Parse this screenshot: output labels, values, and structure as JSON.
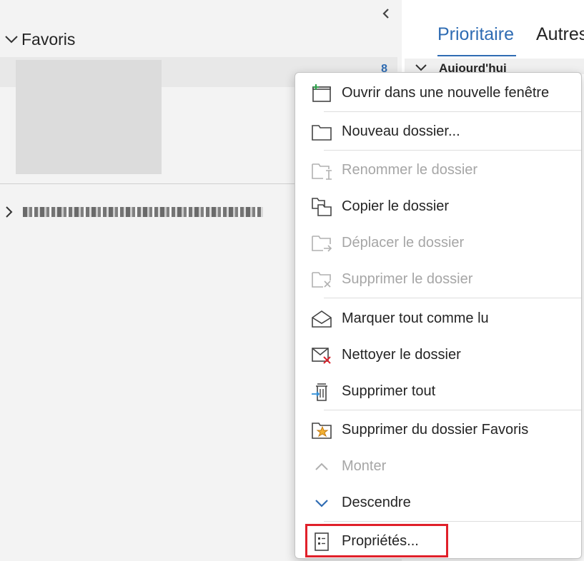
{
  "folder_pane": {
    "favorites_label": "Favoris",
    "favorites_count": "8"
  },
  "mail_list": {
    "tabs": [
      "Prioritaire",
      "Autres"
    ],
    "group_header": "Aujourd'hui"
  },
  "context_menu": {
    "items": [
      {
        "label": "Ouvrir dans une nouvelle fenêtre",
        "icon": "new-window-icon",
        "enabled": true
      },
      {
        "label": "Nouveau dossier...",
        "icon": "new-folder-icon",
        "enabled": true
      },
      {
        "label": "Renommer le dossier",
        "icon": "rename-folder-icon",
        "enabled": false
      },
      {
        "label": "Copier le dossier",
        "icon": "copy-folder-icon",
        "enabled": true
      },
      {
        "label": "Déplacer le dossier",
        "icon": "move-folder-icon",
        "enabled": false
      },
      {
        "label": "Supprimer le dossier",
        "icon": "delete-folder-icon",
        "enabled": false
      },
      {
        "label": "Marquer tout comme lu",
        "icon": "mark-read-icon",
        "enabled": true
      },
      {
        "label": "Nettoyer le dossier",
        "icon": "clean-folder-icon",
        "enabled": true
      },
      {
        "label": "Supprimer tout",
        "icon": "delete-all-icon",
        "enabled": true
      },
      {
        "label": "Supprimer du dossier Favoris",
        "icon": "remove-favorite-icon",
        "enabled": true
      },
      {
        "label": "Monter",
        "icon": "chevron-up-icon",
        "enabled": false
      },
      {
        "label": "Descendre",
        "icon": "chevron-down-icon",
        "enabled": true
      },
      {
        "label": "Propriétés...",
        "icon": "properties-icon",
        "enabled": true
      }
    ]
  },
  "colors": {
    "accent": "#2f6cb3",
    "highlight_border": "#e0202a",
    "disabled_text": "#a6a6a6"
  }
}
